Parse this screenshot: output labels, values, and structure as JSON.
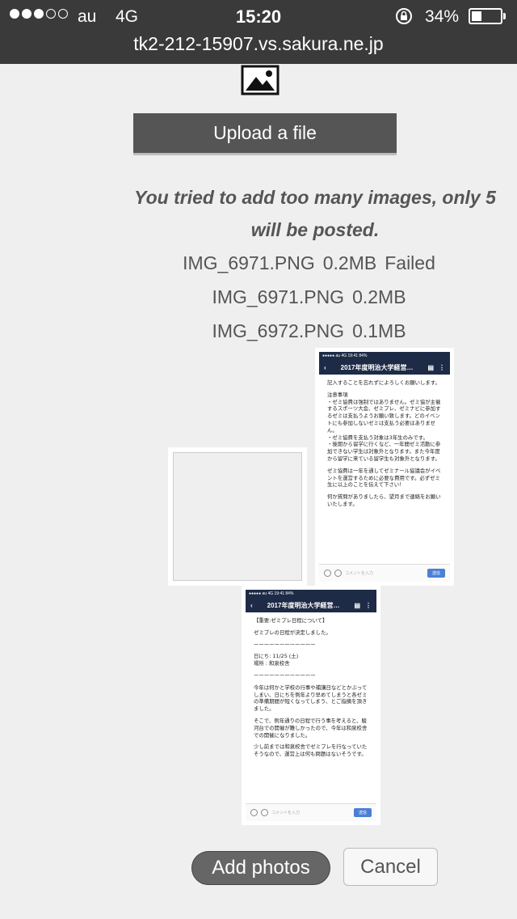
{
  "status_bar": {
    "carrier": "au",
    "network": "4G",
    "time": "15:20",
    "battery_percent": "34%",
    "battery_level": 0.34,
    "signal_bars": 3,
    "signal_total": 5
  },
  "url": "tk2-212-15907.vs.sakura.ne.jp",
  "upload": {
    "label": "Upload a file"
  },
  "warning": "You tried to add too many images, only 5 will be posted.",
  "files": [
    {
      "name": "IMG_6971.PNG",
      "size": "0.2MB",
      "status": "Failed"
    },
    {
      "name": "IMG_6971.PNG",
      "size": "0.2MB",
      "status": ""
    },
    {
      "name": "IMG_6972.PNG",
      "size": "0.1MB",
      "status": ""
    }
  ],
  "thumbnails": {
    "a": {
      "status": "●●●●● au 4G   19:41   84%",
      "title": "2017年度明治大学経営…",
      "paragraphs": [
        "記入することを忘れずによろしくお願いします。",
        "注意事項\n・ゼミ協費は強制ではありません。ゼミ協が主催するスポーツ大会、ゼミプレ、ゼミナビに参加するゼミは支払うようお願い致します。どのイベントにも参加しないゼミは支払う必要はありません。\n・ゼミ協費を支払う対象は3年生のみです。\n・後期から留学に行くなど、一年間ゼミ活動に参加できない学生は対象外となります。また今年度から留学に来ている留学生も対象外となります。",
        "ゼミ協費は一年を通してゼミナール協議会がイベントを運営するために必要な費用です。必ずゼミ生に以上のことを伝えて下さい！",
        "何か質問がありましたら、望月まで連絡をお願いいたします。"
      ],
      "input_placeholder": "コメントを入力",
      "send": "送信"
    },
    "b": {
      "status": "●●●●● au 4G   19:41   84%",
      "title": "2017年度明治大学経営…",
      "paragraphs": [
        "【重要:ゼミプレ日程について】",
        "ゼミプレの日程が決定しました。",
        "ーーーーーーーーーーーー",
        "日にち: 11/25 (土)\n場所 : 和泉校舎",
        "ーーーーーーーーーーーー",
        "今年は何かと学校の行事や補講日などとかぶってしまい、日にちを例年より早めてしまうと各ゼミの準備期間が短くなってしまう、とご指摘を頂きました。",
        "そこで、例年通りの日程で行う事を考えると、駿河台での開催が難しかったので、今年は和泉校舎での開催になりました。",
        "少し前までは和泉校舎でゼミプレを行なっていたそうなので、運営上は何も問題はないそうです。"
      ],
      "input_placeholder": "コメントを入力",
      "send": "送信"
    }
  },
  "buttons": {
    "add_photos": "Add photos",
    "cancel": "Cancel"
  }
}
